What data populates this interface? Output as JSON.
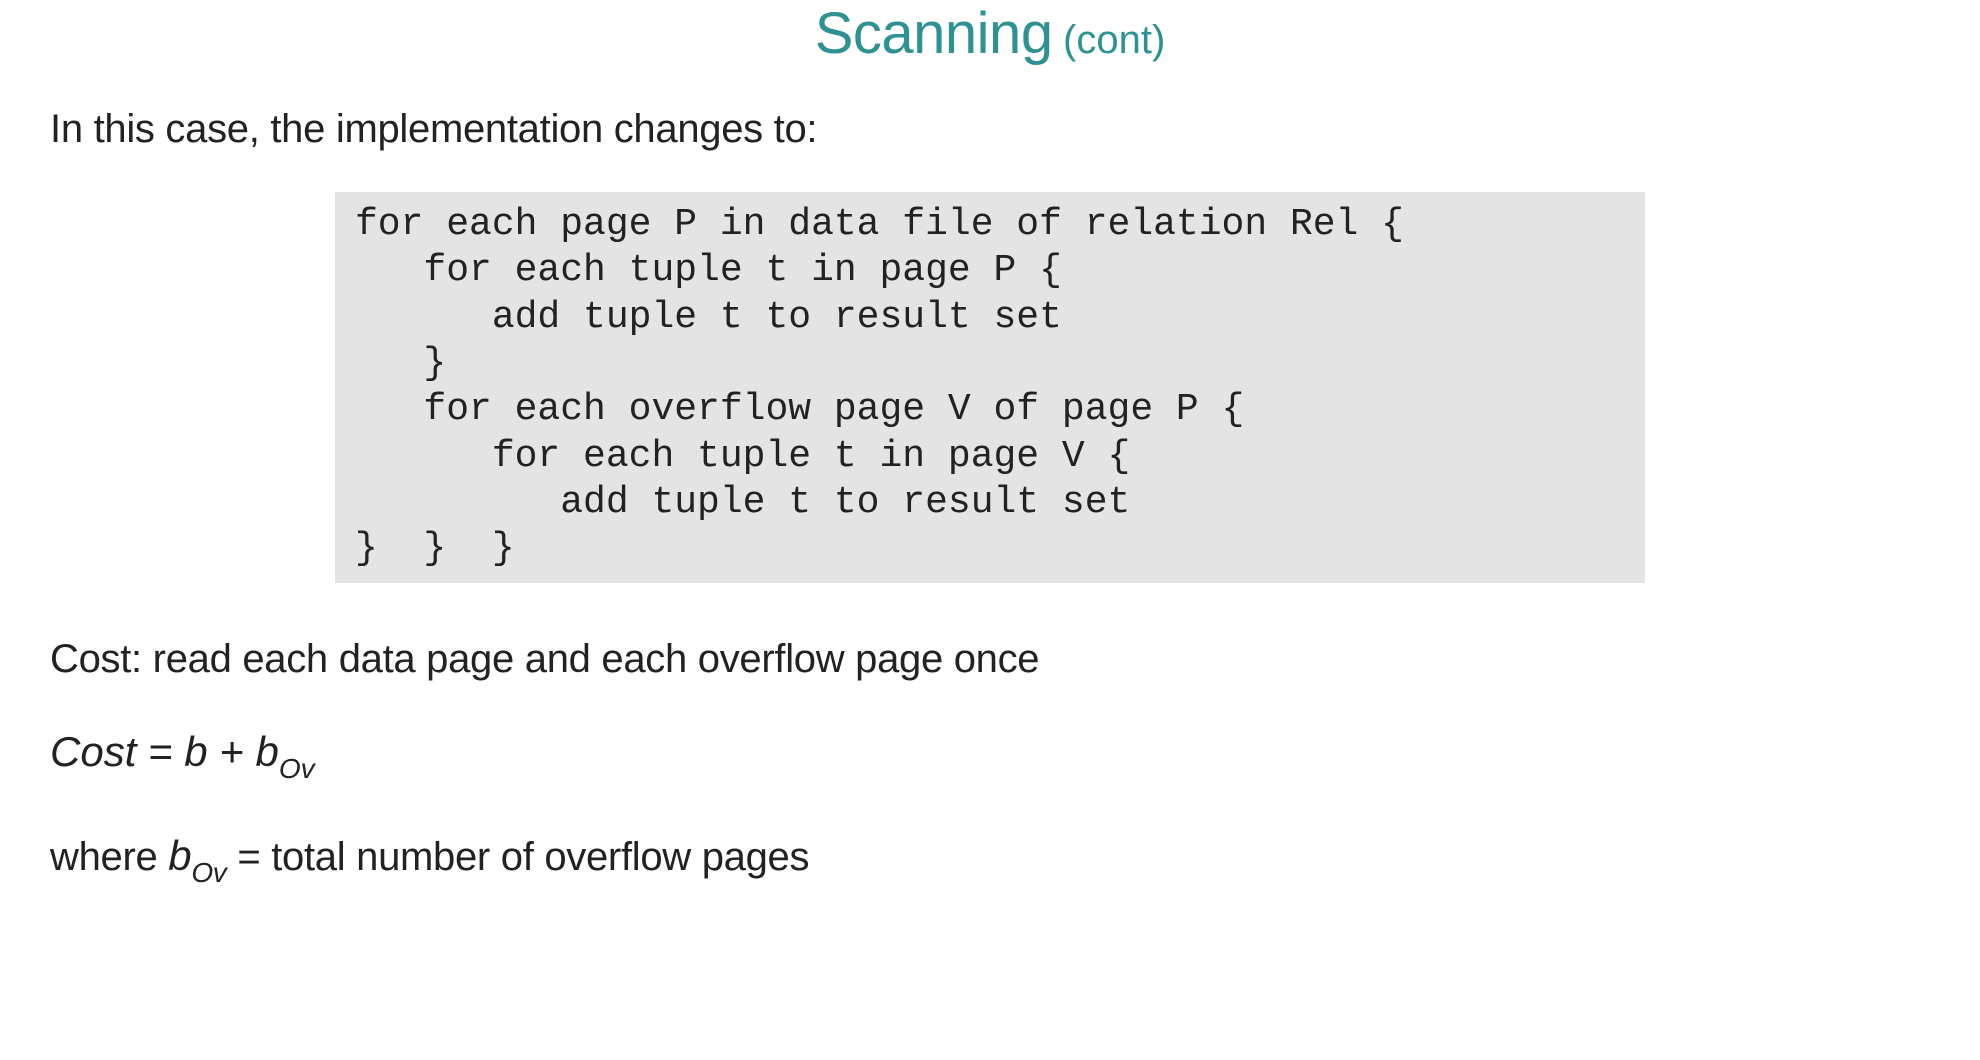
{
  "title": {
    "main": "Scanning",
    "cont": "(cont)"
  },
  "intro": "In this case, the implementation changes to:",
  "code": "for each page P in data file of relation Rel {\n   for each tuple t in page P {\n      add tuple t to result set\n   }\n   for each overflow page V of page P {\n      for each tuple t in page V {\n         add tuple t to result set\n}  }  }",
  "cost_desc": "Cost: read each data page and each overflow page once",
  "formula": {
    "cost_label": "Cost",
    "eq": " = ",
    "b": "b",
    "plus": " + ",
    "bov_b": "b",
    "bov_sub": "Ov"
  },
  "note": {
    "where": "where ",
    "b": "b",
    "sub": "Ov",
    "rest": " = total number of overflow pages"
  }
}
